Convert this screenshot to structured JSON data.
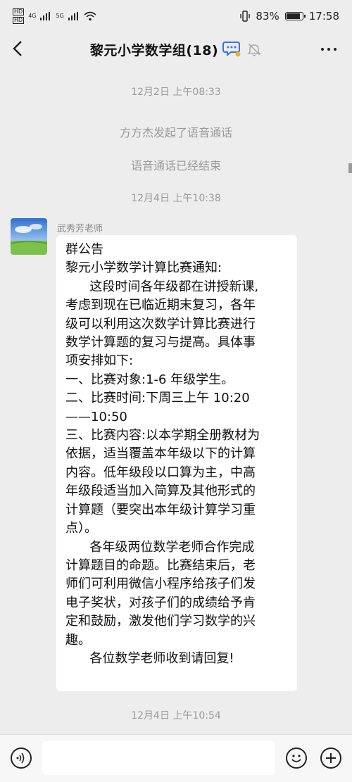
{
  "status_bar": {
    "network_left": "HD",
    "network_types": [
      "4G",
      "5G"
    ],
    "battery_percent": "83%",
    "battery_level": 0.83,
    "time": "17:58"
  },
  "header": {
    "title": "黎元小学数学组(18)",
    "icons": [
      "back-arrow-icon",
      "chat-bubble-icon",
      "mute-bell-icon",
      "more-dots-icon"
    ]
  },
  "messages": {
    "time1": "12月2日 上午08:33",
    "system1": "方方杰发起了语音通话",
    "system2": "语音通话已经结束",
    "time2": "12月4日 上午10:38",
    "sender": "武秀芳老师",
    "bubble_lines": [
      "群公告",
      "黎元小学数学计算比赛通知:",
      "      这段时间各年级都在讲授新课,",
      "考虑到现在已临近期末复习，各年",
      "级可以利用这次数学计算比赛进行",
      "数学计算题的复习与提高。具体事",
      "项安排如下:",
      "一、比赛对象:1-6 年级学生。",
      "二、比赛时间:下周三上午 10:20",
      "——10:50",
      "三、比赛内容:以本学期全册教材为",
      "依据，适当覆盖本年级以下的计算",
      "内容。低年级段以口算为主，中高",
      "年级段适当加入简算及其他形式的",
      "计算题（要突出本年级计算学习重",
      "点）。",
      "      各年级两位数学老师合作完成",
      "计算题目的命题。比赛结束后，老",
      "师们可利用微信小程序给孩子们发",
      "电子奖状，对孩子们的成绩给予肯",
      "定和鼓励，激发他们学习数学的兴",
      "趣。",
      "      各位数学老师收到请回复!"
    ],
    "time3": "12月4日 上午10:54"
  },
  "bottom_bar": {
    "icons": [
      "voice-icon",
      "emoji-icon",
      "add-icon"
    ]
  }
}
